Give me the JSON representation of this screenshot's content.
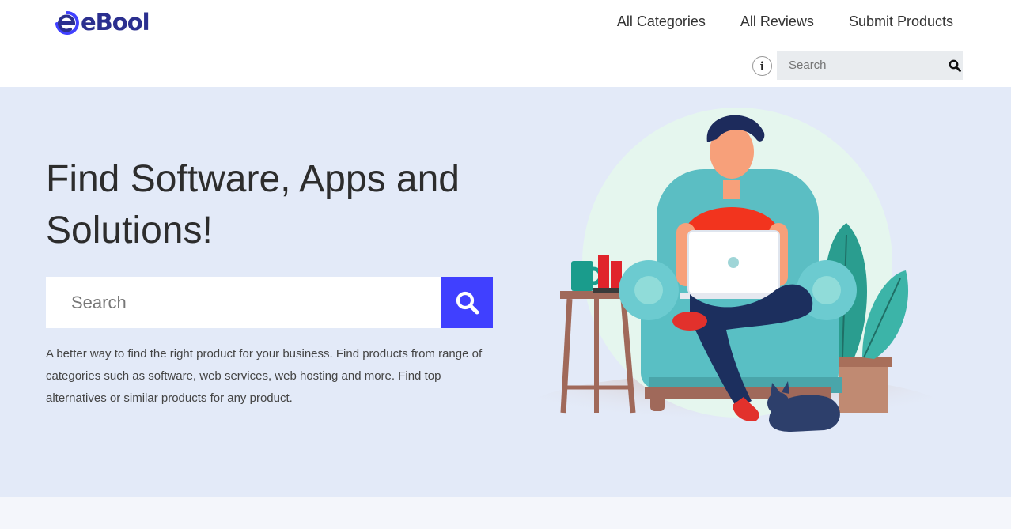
{
  "brand": {
    "name": "eBool",
    "accent": "#4040ff",
    "logo_color": "#2b2f8f"
  },
  "nav": {
    "items": [
      {
        "label": "All Categories"
      },
      {
        "label": "All Reviews"
      },
      {
        "label": "Submit Products"
      }
    ]
  },
  "topsearch": {
    "placeholder": "Search",
    "info_icon": "i"
  },
  "hero": {
    "title": "Find Software, Apps and Solutions!",
    "search_placeholder": "Search",
    "description": "A better way to find the right product for your business. Find products from range of categories such as software, web services, web hosting and more. Find top alternatives or similar products for any product.",
    "background": "#e3eaf8"
  }
}
